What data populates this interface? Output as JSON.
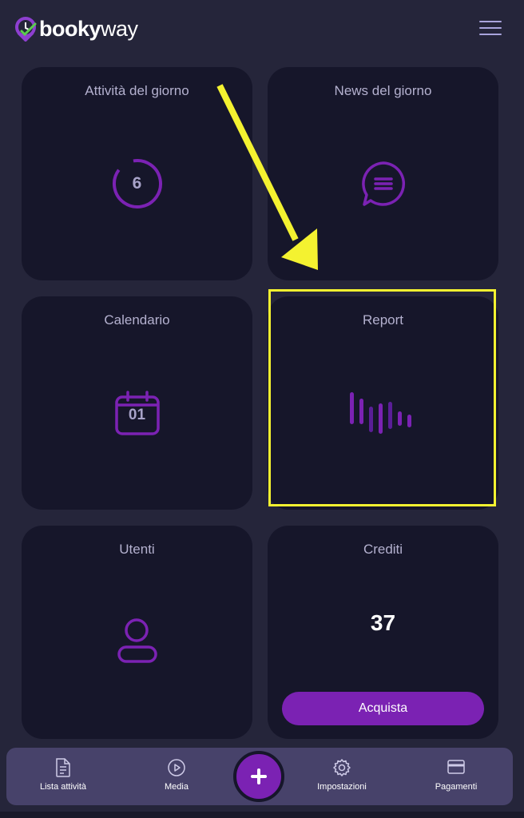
{
  "app": {
    "logo_text_bold": "booky",
    "logo_text_light": "way"
  },
  "header": {
    "menu_icon": "hamburger-menu-icon"
  },
  "cards": {
    "activities": {
      "title": "Attività del giorno",
      "count": "6",
      "icon": "progress-ring-icon"
    },
    "news": {
      "title": "News del giorno",
      "icon": "chat-bubble-icon"
    },
    "calendar": {
      "title": "Calendario",
      "day": "01",
      "icon": "calendar-icon"
    },
    "report": {
      "title": "Report",
      "icon": "audio-bars-icon"
    },
    "users": {
      "title": "Utenti",
      "icon": "user-icon"
    },
    "credits": {
      "title": "Crediti",
      "value": "37",
      "button_label": "Acquista"
    }
  },
  "bottom_nav": {
    "items": [
      {
        "label": "Lista attività",
        "icon": "document-list-icon"
      },
      {
        "label": "Media",
        "icon": "play-circle-icon"
      },
      {
        "label": "Impostazioni",
        "icon": "gear-icon"
      },
      {
        "label": "Pagamenti",
        "icon": "credit-card-icon"
      }
    ],
    "fab_icon": "plus-icon"
  },
  "colors": {
    "background": "#25253a",
    "card": "#16162a",
    "accent": "#7b22b3",
    "highlight": "#f4f230",
    "nav": "#47426a"
  }
}
